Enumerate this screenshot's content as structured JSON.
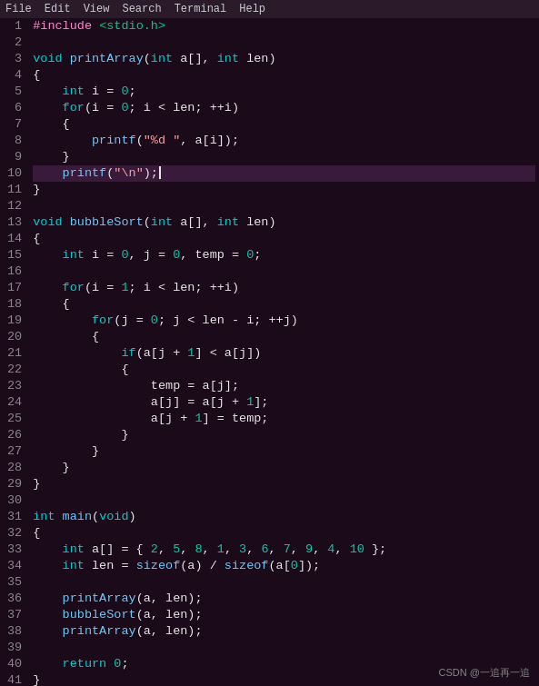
{
  "menu": {
    "items": [
      "File",
      "Edit",
      "View",
      "Search",
      "Terminal",
      "Help"
    ]
  },
  "watermark": "CSDN @一追再一追",
  "lines": [
    {
      "num": 1,
      "tokens": [
        {
          "type": "macro",
          "text": "#include "
        },
        {
          "type": "header",
          "text": "<stdio.h>"
        }
      ]
    },
    {
      "num": 2,
      "tokens": []
    },
    {
      "num": 3,
      "tokens": [
        {
          "type": "kw",
          "text": "void "
        },
        {
          "type": "fn",
          "text": "printArray"
        },
        {
          "type": "plain",
          "text": "("
        },
        {
          "type": "kw",
          "text": "int "
        },
        {
          "type": "plain",
          "text": "a[], "
        },
        {
          "type": "kw",
          "text": "int "
        },
        {
          "type": "plain",
          "text": "len)"
        }
      ]
    },
    {
      "num": 4,
      "tokens": [
        {
          "type": "plain",
          "text": "{"
        }
      ]
    },
    {
      "num": 5,
      "tokens": [
        {
          "type": "plain",
          "text": "    "
        },
        {
          "type": "kw",
          "text": "int "
        },
        {
          "type": "plain",
          "text": "i = "
        },
        {
          "type": "num",
          "text": "0"
        },
        {
          "type": "plain",
          "text": ";"
        }
      ]
    },
    {
      "num": 6,
      "tokens": [
        {
          "type": "plain",
          "text": "    "
        },
        {
          "type": "kw",
          "text": "for"
        },
        {
          "type": "plain",
          "text": "(i = "
        },
        {
          "type": "num",
          "text": "0"
        },
        {
          "type": "plain",
          "text": "; i < len; ++i)"
        }
      ]
    },
    {
      "num": 7,
      "tokens": [
        {
          "type": "plain",
          "text": "    {"
        }
      ]
    },
    {
      "num": 8,
      "tokens": [
        {
          "type": "plain",
          "text": "        "
        },
        {
          "type": "fn",
          "text": "printf"
        },
        {
          "type": "plain",
          "text": "("
        },
        {
          "type": "str",
          "text": "\"%d \""
        },
        {
          "type": "plain",
          "text": ", a[i]);"
        }
      ]
    },
    {
      "num": 9,
      "tokens": [
        {
          "type": "plain",
          "text": "    }"
        }
      ]
    },
    {
      "num": 10,
      "tokens": [
        {
          "type": "plain",
          "text": "    "
        },
        {
          "type": "fn",
          "text": "printf"
        },
        {
          "type": "plain",
          "text": "("
        },
        {
          "type": "str",
          "text": "\"\\n\""
        },
        {
          "type": "plain",
          "text": ");"
        }
      ],
      "highlighted": true
    },
    {
      "num": 11,
      "tokens": [
        {
          "type": "plain",
          "text": "}"
        }
      ]
    },
    {
      "num": 12,
      "tokens": []
    },
    {
      "num": 13,
      "tokens": [
        {
          "type": "kw",
          "text": "void "
        },
        {
          "type": "fn",
          "text": "bubbleSort"
        },
        {
          "type": "plain",
          "text": "("
        },
        {
          "type": "kw",
          "text": "int "
        },
        {
          "type": "plain",
          "text": "a[], "
        },
        {
          "type": "kw",
          "text": "int "
        },
        {
          "type": "plain",
          "text": "len)"
        }
      ]
    },
    {
      "num": 14,
      "tokens": [
        {
          "type": "plain",
          "text": "{"
        }
      ]
    },
    {
      "num": 15,
      "tokens": [
        {
          "type": "plain",
          "text": "    "
        },
        {
          "type": "kw",
          "text": "int "
        },
        {
          "type": "plain",
          "text": "i = "
        },
        {
          "type": "num",
          "text": "0"
        },
        {
          "type": "plain",
          "text": ", j = "
        },
        {
          "type": "num",
          "text": "0"
        },
        {
          "type": "plain",
          "text": ", temp = "
        },
        {
          "type": "num",
          "text": "0"
        },
        {
          "type": "plain",
          "text": ";"
        }
      ]
    },
    {
      "num": 16,
      "tokens": []
    },
    {
      "num": 17,
      "tokens": [
        {
          "type": "plain",
          "text": "    "
        },
        {
          "type": "kw",
          "text": "for"
        },
        {
          "type": "plain",
          "text": "(i = "
        },
        {
          "type": "num",
          "text": "1"
        },
        {
          "type": "plain",
          "text": "; i < len; ++i)"
        }
      ]
    },
    {
      "num": 18,
      "tokens": [
        {
          "type": "plain",
          "text": "    {"
        }
      ]
    },
    {
      "num": 19,
      "tokens": [
        {
          "type": "plain",
          "text": "        "
        },
        {
          "type": "kw",
          "text": "for"
        },
        {
          "type": "plain",
          "text": "(j = "
        },
        {
          "type": "num",
          "text": "0"
        },
        {
          "type": "plain",
          "text": "; j < len - i; ++j)"
        }
      ]
    },
    {
      "num": 20,
      "tokens": [
        {
          "type": "plain",
          "text": "        {"
        }
      ]
    },
    {
      "num": 21,
      "tokens": [
        {
          "type": "plain",
          "text": "            "
        },
        {
          "type": "kw",
          "text": "if"
        },
        {
          "type": "plain",
          "text": "(a[j + "
        },
        {
          "type": "num",
          "text": "1"
        },
        {
          "type": "plain",
          "text": "] < a[j])"
        }
      ]
    },
    {
      "num": 22,
      "tokens": [
        {
          "type": "plain",
          "text": "            {"
        }
      ]
    },
    {
      "num": 23,
      "tokens": [
        {
          "type": "plain",
          "text": "                temp = a[j];"
        }
      ]
    },
    {
      "num": 24,
      "tokens": [
        {
          "type": "plain",
          "text": "                a[j] = a[j + "
        },
        {
          "type": "num",
          "text": "1"
        },
        {
          "type": "plain",
          "text": "];"
        }
      ]
    },
    {
      "num": 25,
      "tokens": [
        {
          "type": "plain",
          "text": "                a[j + "
        },
        {
          "type": "num",
          "text": "1"
        },
        {
          "type": "plain",
          "text": "] = temp;"
        }
      ]
    },
    {
      "num": 26,
      "tokens": [
        {
          "type": "plain",
          "text": "            }"
        }
      ]
    },
    {
      "num": 27,
      "tokens": [
        {
          "type": "plain",
          "text": "        }"
        }
      ]
    },
    {
      "num": 28,
      "tokens": [
        {
          "type": "plain",
          "text": "    }"
        }
      ]
    },
    {
      "num": 29,
      "tokens": [
        {
          "type": "plain",
          "text": "}"
        }
      ]
    },
    {
      "num": 30,
      "tokens": []
    },
    {
      "num": 31,
      "tokens": [
        {
          "type": "kw",
          "text": "int "
        },
        {
          "type": "fn",
          "text": "main"
        },
        {
          "type": "plain",
          "text": "("
        },
        {
          "type": "kw",
          "text": "void"
        },
        {
          "type": "plain",
          "text": ")"
        }
      ]
    },
    {
      "num": 32,
      "tokens": [
        {
          "type": "plain",
          "text": "{"
        }
      ]
    },
    {
      "num": 33,
      "tokens": [
        {
          "type": "plain",
          "text": "    "
        },
        {
          "type": "kw",
          "text": "int "
        },
        {
          "type": "plain",
          "text": "a[] = { "
        },
        {
          "type": "num",
          "text": "2"
        },
        {
          "type": "plain",
          "text": ", "
        },
        {
          "type": "num",
          "text": "5"
        },
        {
          "type": "plain",
          "text": ", "
        },
        {
          "type": "num",
          "text": "8"
        },
        {
          "type": "plain",
          "text": ", "
        },
        {
          "type": "num",
          "text": "1"
        },
        {
          "type": "plain",
          "text": ", "
        },
        {
          "type": "num",
          "text": "3"
        },
        {
          "type": "plain",
          "text": ", "
        },
        {
          "type": "num",
          "text": "6"
        },
        {
          "type": "plain",
          "text": ", "
        },
        {
          "type": "num",
          "text": "7"
        },
        {
          "type": "plain",
          "text": ", "
        },
        {
          "type": "num",
          "text": "9"
        },
        {
          "type": "plain",
          "text": ", "
        },
        {
          "type": "num",
          "text": "4"
        },
        {
          "type": "plain",
          "text": ", "
        },
        {
          "type": "num",
          "text": "10"
        },
        {
          "type": "plain",
          "text": " };"
        }
      ]
    },
    {
      "num": 34,
      "tokens": [
        {
          "type": "plain",
          "text": "    "
        },
        {
          "type": "kw",
          "text": "int "
        },
        {
          "type": "plain",
          "text": "len = "
        },
        {
          "type": "fn",
          "text": "sizeof"
        },
        {
          "type": "plain",
          "text": "(a) / "
        },
        {
          "type": "fn",
          "text": "sizeof"
        },
        {
          "type": "plain",
          "text": "(a["
        },
        {
          "type": "num",
          "text": "0"
        },
        {
          "type": "plain",
          "text": "]);"
        }
      ]
    },
    {
      "num": 35,
      "tokens": []
    },
    {
      "num": 36,
      "tokens": [
        {
          "type": "plain",
          "text": "    "
        },
        {
          "type": "fn",
          "text": "printArray"
        },
        {
          "type": "plain",
          "text": "(a, len);"
        }
      ]
    },
    {
      "num": 37,
      "tokens": [
        {
          "type": "plain",
          "text": "    "
        },
        {
          "type": "fn",
          "text": "bubbleSort"
        },
        {
          "type": "plain",
          "text": "(a, len);"
        }
      ]
    },
    {
      "num": 38,
      "tokens": [
        {
          "type": "plain",
          "text": "    "
        },
        {
          "type": "fn",
          "text": "printArray"
        },
        {
          "type": "plain",
          "text": "(a, len);"
        }
      ]
    },
    {
      "num": 39,
      "tokens": []
    },
    {
      "num": 40,
      "tokens": [
        {
          "type": "plain",
          "text": "    "
        },
        {
          "type": "kw",
          "text": "return "
        },
        {
          "type": "num",
          "text": "0"
        },
        {
          "type": "plain",
          "text": ";"
        }
      ]
    },
    {
      "num": 41,
      "tokens": [
        {
          "type": "plain",
          "text": "}"
        }
      ]
    }
  ]
}
